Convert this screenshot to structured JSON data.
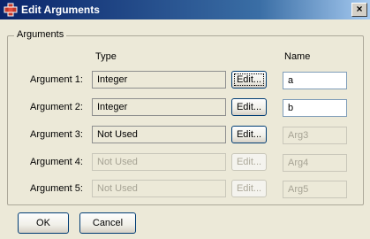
{
  "window": {
    "title": "Edit Arguments",
    "close_glyph": "×"
  },
  "group": {
    "label": "Arguments"
  },
  "headers": {
    "type": "Type",
    "name": "Name"
  },
  "arguments": [
    {
      "label": "Argument 1:",
      "type": "Integer",
      "edit": "Edit...",
      "name": "a",
      "enabled": true,
      "edit_focused": true
    },
    {
      "label": "Argument 2:",
      "type": "Integer",
      "edit": "Edit...",
      "name": "b",
      "enabled": true
    },
    {
      "label": "Argument 3:",
      "type": "Not Used",
      "edit": "Edit...",
      "name": "Arg3",
      "enabled": true,
      "name_enabled": false
    },
    {
      "label": "Argument 4:",
      "type": "Not Used",
      "edit": "Edit...",
      "name": "Arg4",
      "enabled": false
    },
    {
      "label": "Argument 5:",
      "type": "Not Used",
      "edit": "Edit...",
      "name": "Arg5",
      "enabled": false
    }
  ],
  "buttons": {
    "ok": "OK",
    "cancel": "Cancel"
  },
  "colors": {
    "titlebar": "#0a246a",
    "dialog_bg": "#ece9d8",
    "field_border": "#7f9db9",
    "disabled_text": "#a6a394"
  },
  "icons": {
    "app": "app-window-icon",
    "close": "close-icon"
  }
}
